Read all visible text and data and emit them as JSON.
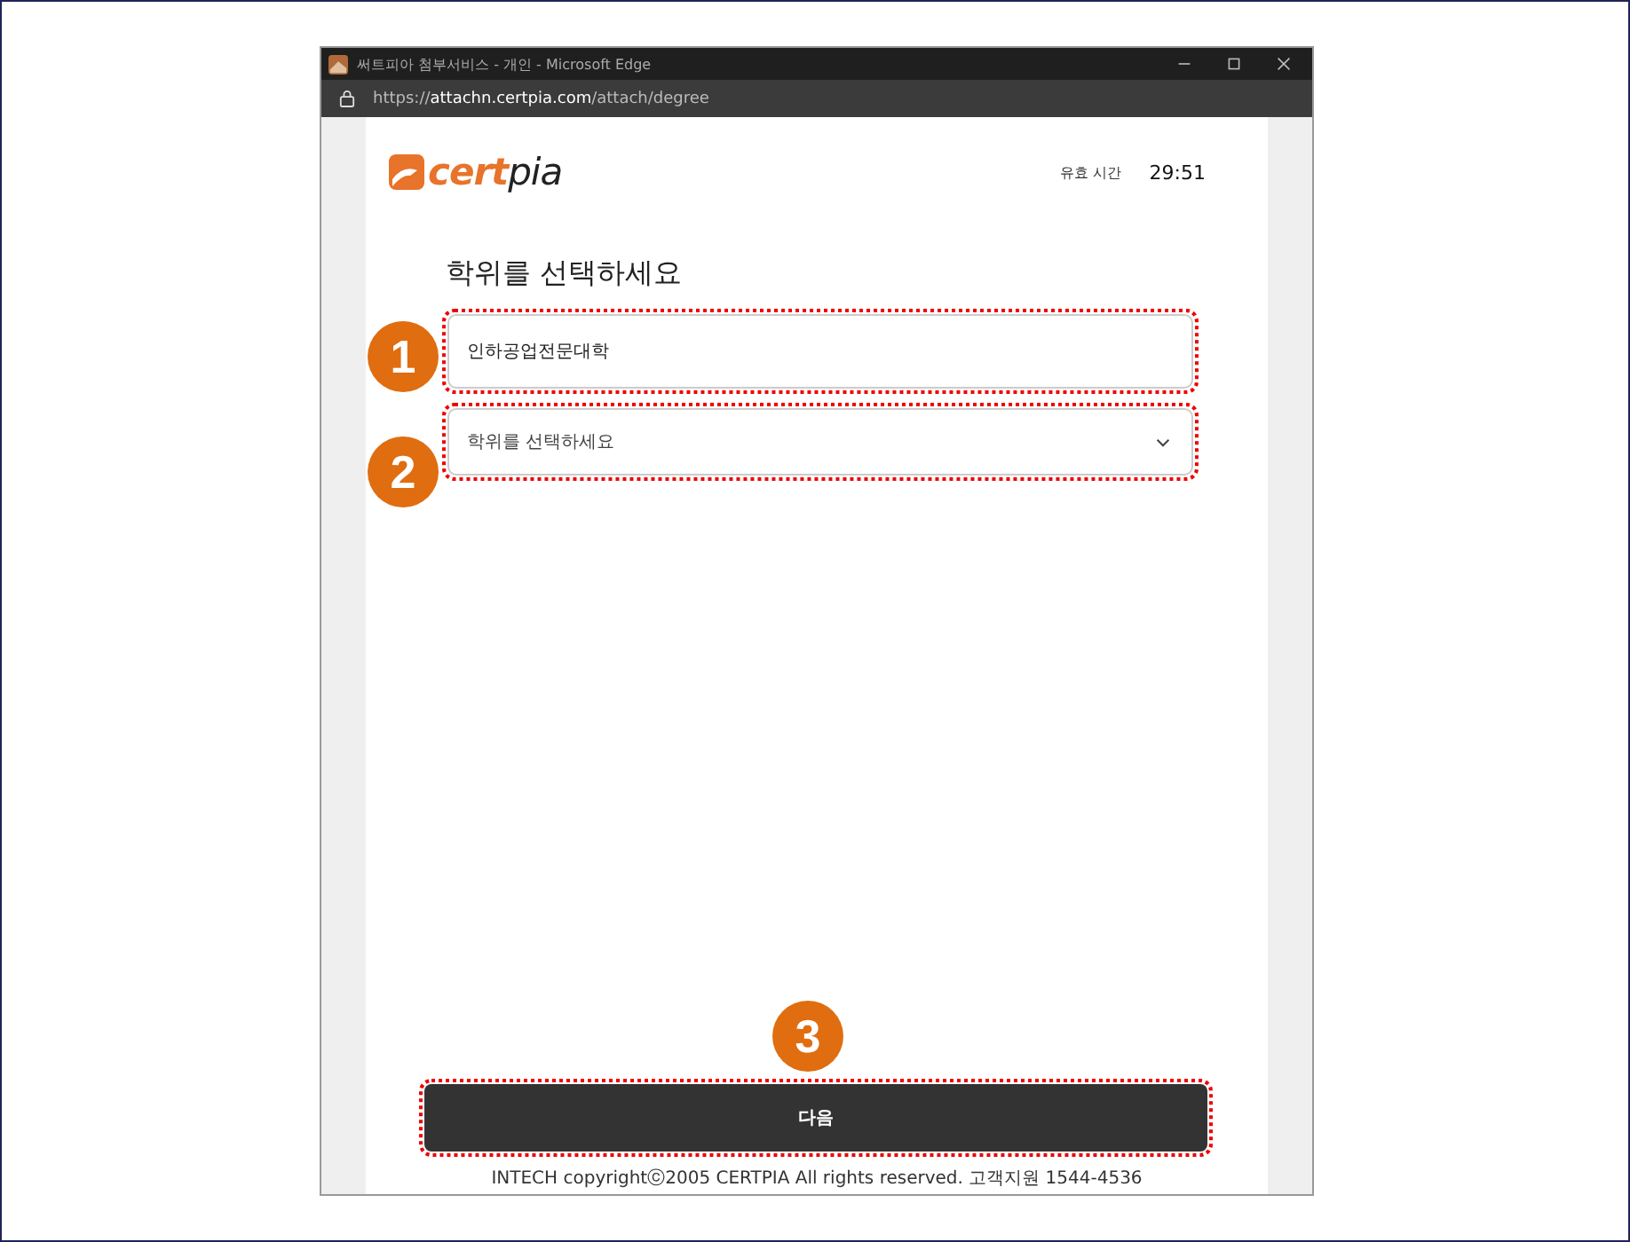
{
  "window": {
    "title": "써트피아 첨부서비스 - 개인 - Microsoft Edge",
    "url_prefix": "https://",
    "url_host": "attachn.certpia.com",
    "url_path": "/attach/degree"
  },
  "header": {
    "logo": "**cert**pia",
    "timer_label": "유효 시간",
    "timer": "29:51"
  },
  "heading": "학위를 선택하세요",
  "school_field": {
    "value": "인하공업전문대학"
  },
  "degree_select": {
    "placeholder": "학위를 선택하세요"
  },
  "next_button": "다음",
  "footer": "INTECH copyrightⓒ2005 CERTPIA All rights reserved. 고객지원 1544-4536",
  "callouts": [
    {
      "number": "1"
    },
    {
      "number": "2"
    },
    {
      "number": "3"
    }
  ]
}
